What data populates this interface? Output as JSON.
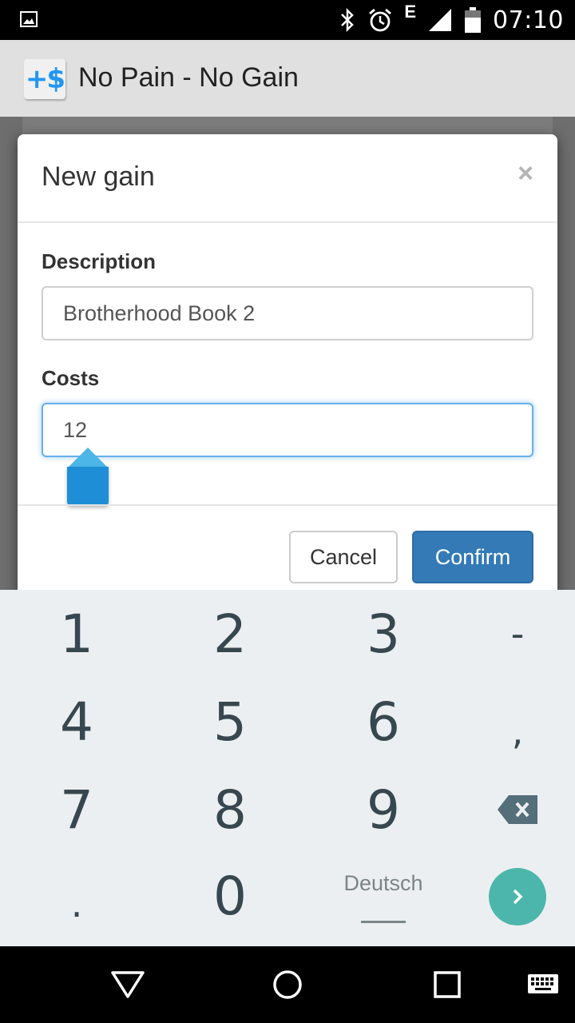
{
  "status_bar": {
    "time": "07:10",
    "network_type": "E",
    "icons": [
      "image-icon",
      "bluetooth-icon",
      "alarm-icon",
      "signal-icon",
      "battery-icon"
    ]
  },
  "app_bar": {
    "icon_text": "+$",
    "title": "No Pain - No Gain"
  },
  "modal": {
    "title": "New gain",
    "close_label": "×",
    "description": {
      "label": "Description",
      "value": "Brotherhood Book 2"
    },
    "costs": {
      "label": "Costs",
      "value": "12"
    },
    "cancel_label": "Cancel",
    "confirm_label": "Confirm"
  },
  "keyboard": {
    "keys": {
      "k1": "1",
      "k2": "2",
      "k3": "3",
      "kminus": "-",
      "k4": "4",
      "k5": "5",
      "k6": "6",
      "kcomma": ",",
      "k7": "7",
      "k8": "8",
      "k9": "9",
      "kdot": ".",
      "k0": "0"
    },
    "language": "Deutsch",
    "accent_color": "#4db6ac"
  },
  "nav_bar": {
    "icons": [
      "back-icon",
      "home-icon",
      "recents-icon",
      "keyboard-icon"
    ]
  },
  "colors": {
    "primary_button": "#337ab7",
    "focus_border": "#66afe9",
    "app_icon": "#2196f3"
  }
}
